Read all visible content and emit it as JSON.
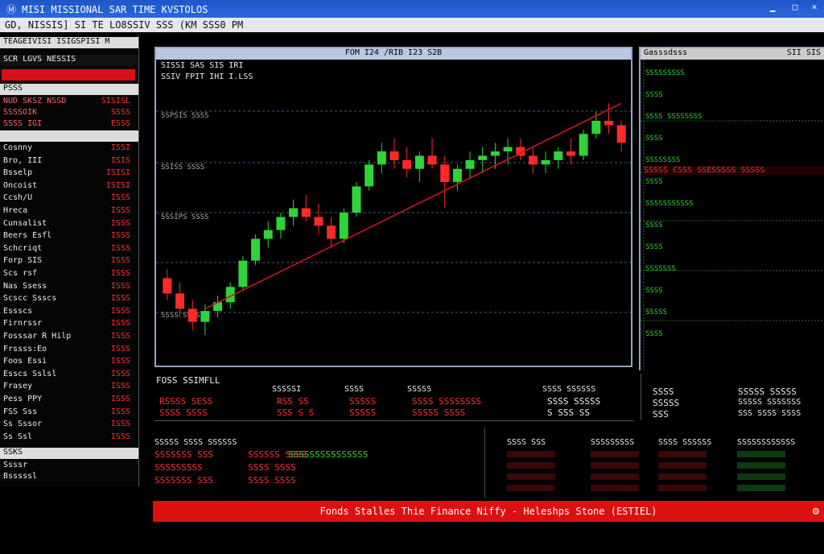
{
  "window": {
    "title": "Ⓜ MISI MISSIONAL SAR TIME KVSTOLOS"
  },
  "menubar": {
    "text": "GD, NISSIS] SI TE LO8SSIV SSS (KM SSS0 PM"
  },
  "left_panel": {
    "title": "TEAGEIVISI ISIGSPISI M",
    "header": "SCR LGVS NESSIS",
    "quotes_header": "PSSS",
    "summary": [
      {
        "name": "NUD SKSZ NSSD",
        "value": "SISISL"
      },
      {
        "name": "SSSSOIK",
        "value": "SSSS"
      },
      {
        "name": "SSSS IGI",
        "value": "ESSS"
      }
    ],
    "rows": [
      {
        "name": "Cosnny",
        "value": "ISSI"
      },
      {
        "name": "Bro, III",
        "value": "ISIS"
      },
      {
        "name": "Bsselp",
        "value": "ISISI"
      },
      {
        "name": "Oncoist",
        "value": "ISISI"
      },
      {
        "name": "Ccsh/U",
        "value": "ISSS"
      },
      {
        "name": "Hreca",
        "value": "ISSS"
      },
      {
        "name": "Cunsalist",
        "value": "ISSS"
      },
      {
        "name": "Beers Esfl",
        "value": "ISSS"
      },
      {
        "name": "Schcriqt",
        "value": "ISSS"
      },
      {
        "name": "Forp SIS",
        "value": "ISSS"
      },
      {
        "name": "Scs rsf",
        "value": "ISSS"
      },
      {
        "name": "Nas Ssess",
        "value": "ISSS"
      },
      {
        "name": "Scscc Ssscs",
        "value": "ISSS"
      },
      {
        "name": "Essscs",
        "value": "ISSS"
      },
      {
        "name": "Firnrssr",
        "value": "ISSS"
      },
      {
        "name": "Fosssar R Hilp",
        "value": "ISSS"
      },
      {
        "name": "Frssss:Eo",
        "value": "ISSS"
      },
      {
        "name": "Foos Essi",
        "value": "ISSS"
      },
      {
        "name": "Esscs Sslsl",
        "value": "ISSS"
      },
      {
        "name": "Frasey",
        "value": "ISSS"
      },
      {
        "name": "Pess PPY",
        "value": "ISSS"
      },
      {
        "name": "FSS Sss",
        "value": "ISSS"
      },
      {
        "name": "Ss Sssor",
        "value": "ISSS"
      },
      {
        "name": "Ss Ssl",
        "value": "ISSS"
      }
    ],
    "footer_header": "SSKS",
    "footer_rows": [
      "Ssssr",
      "Bsssssl"
    ]
  },
  "chart_window": {
    "caption": "FOM I24 /RIB I23 S2B",
    "info_line1": "SISSI SAS SIS IRI",
    "info_line2": "SSIV FPIT IHI I.LSS",
    "grid_labels": [
      "SSPSIS SSSS",
      "SSISS SSSS",
      "SSSIPS SSSS",
      "SSSS SSSS"
    ]
  },
  "chart_data": {
    "type": "candlestick",
    "title": "FOM I24 /RIB I23 S2B",
    "candles": [
      {
        "o": 60,
        "h": 64,
        "l": 50,
        "c": 53,
        "up": false
      },
      {
        "o": 53,
        "h": 58,
        "l": 42,
        "c": 46,
        "up": false
      },
      {
        "o": 46,
        "h": 50,
        "l": 36,
        "c": 40,
        "up": false
      },
      {
        "o": 40,
        "h": 48,
        "l": 34,
        "c": 45,
        "up": true
      },
      {
        "o": 45,
        "h": 52,
        "l": 42,
        "c": 49,
        "up": true
      },
      {
        "o": 49,
        "h": 58,
        "l": 46,
        "c": 56,
        "up": true
      },
      {
        "o": 56,
        "h": 70,
        "l": 54,
        "c": 68,
        "up": true
      },
      {
        "o": 68,
        "h": 80,
        "l": 66,
        "c": 78,
        "up": true
      },
      {
        "o": 78,
        "h": 86,
        "l": 74,
        "c": 82,
        "up": true
      },
      {
        "o": 82,
        "h": 90,
        "l": 78,
        "c": 88,
        "up": true
      },
      {
        "o": 88,
        "h": 96,
        "l": 84,
        "c": 92,
        "up": true
      },
      {
        "o": 92,
        "h": 98,
        "l": 86,
        "c": 88,
        "up": false
      },
      {
        "o": 88,
        "h": 94,
        "l": 80,
        "c": 84,
        "up": false
      },
      {
        "o": 84,
        "h": 88,
        "l": 74,
        "c": 78,
        "up": false
      },
      {
        "o": 78,
        "h": 92,
        "l": 76,
        "c": 90,
        "up": true
      },
      {
        "o": 90,
        "h": 104,
        "l": 88,
        "c": 102,
        "up": true
      },
      {
        "o": 102,
        "h": 114,
        "l": 100,
        "c": 112,
        "up": true
      },
      {
        "o": 112,
        "h": 122,
        "l": 108,
        "c": 118,
        "up": true
      },
      {
        "o": 118,
        "h": 124,
        "l": 110,
        "c": 114,
        "up": false
      },
      {
        "o": 114,
        "h": 120,
        "l": 106,
        "c": 110,
        "up": false
      },
      {
        "o": 110,
        "h": 118,
        "l": 104,
        "c": 116,
        "up": true
      },
      {
        "o": 116,
        "h": 124,
        "l": 110,
        "c": 112,
        "up": false
      },
      {
        "o": 112,
        "h": 116,
        "l": 92,
        "c": 104,
        "up": false
      },
      {
        "o": 104,
        "h": 112,
        "l": 100,
        "c": 110,
        "up": true
      },
      {
        "o": 110,
        "h": 118,
        "l": 106,
        "c": 114,
        "up": true
      },
      {
        "o": 114,
        "h": 120,
        "l": 108,
        "c": 116,
        "up": true
      },
      {
        "o": 116,
        "h": 122,
        "l": 110,
        "c": 118,
        "up": true
      },
      {
        "o": 118,
        "h": 124,
        "l": 112,
        "c": 120,
        "up": true
      },
      {
        "o": 120,
        "h": 124,
        "l": 114,
        "c": 116,
        "up": false
      },
      {
        "o": 116,
        "h": 120,
        "l": 108,
        "c": 112,
        "up": false
      },
      {
        "o": 112,
        "h": 118,
        "l": 108,
        "c": 114,
        "up": true
      },
      {
        "o": 114,
        "h": 120,
        "l": 110,
        "c": 118,
        "up": true
      },
      {
        "o": 118,
        "h": 124,
        "l": 112,
        "c": 116,
        "up": false
      },
      {
        "o": 116,
        "h": 128,
        "l": 114,
        "c": 126,
        "up": true
      },
      {
        "o": 126,
        "h": 136,
        "l": 124,
        "c": 132,
        "up": true
      },
      {
        "o": 132,
        "h": 140,
        "l": 126,
        "c": 130,
        "up": false
      },
      {
        "o": 130,
        "h": 132,
        "l": 118,
        "c": 122,
        "up": false
      }
    ],
    "trendline": [
      {
        "i": 3,
        "v": 46
      },
      {
        "i": 36,
        "v": 140
      }
    ],
    "ylim": [
      20,
      160
    ],
    "colors": {
      "up": "#2fd43a",
      "down": "#ff2a2a",
      "trend": "#c81818"
    }
  },
  "right_panel": {
    "caption": "Gasssdsss",
    "caption_right": "SII SIS",
    "rows": [
      "SSSSSSSSS",
      "SSSS",
      "SSSS SSSSSSSS",
      "SSSS",
      "SSSSSSSS",
      "SSSS",
      "SSSSSSSSSSS",
      "SSSS",
      "SSSS",
      "SSSSSSS",
      "SSSS",
      "SSSSS",
      "SSSS"
    ],
    "red_row": "SSSSS CSSS SSESSSSS SSSSS"
  },
  "mid_info": {
    "label": "FOSS SSIMFLL",
    "cols": [
      {
        "head": "",
        "l1": "RSSSS SESS",
        "l2": "SSSS SSSS"
      },
      {
        "head": "SSSSSI",
        "l1": "RSS SS",
        "l2": "SSS S S"
      },
      {
        "head": "SSSS",
        "l1": "SSSSS",
        "l2": "SSSSS"
      },
      {
        "head": "SSSSS",
        "l1": "SSSS SSSSSSSS",
        "l2": "SSSSS SSSS"
      },
      {
        "head": "SSSS SSSSSS",
        "l1": "SSSS SSSSS",
        "l2": "S SSS SS"
      }
    ]
  },
  "right_info": {
    "c1": {
      "head": "SSSS",
      "l1": "SSSSS",
      "l2": "SSS"
    },
    "c2": {
      "head": "SSSSS SSSSS",
      "l1": "SSSSS SSSSSSS",
      "l2": "SSS SSSS SSSS"
    }
  },
  "bottom": {
    "label": "SSSSS SSSS SSSSSS",
    "cols": [
      {
        "lines": [
          "SSSSSSS SSS",
          "SSSSSSSSS",
          "SSSSSSS SSS"
        ]
      },
      {
        "lines": [
          "SSSSSS SSSS",
          "SSSS SSSS",
          "SSSS SSSS"
        ]
      },
      {
        "lines": [
          "SSSSSSSSSSSSSSS"
        ]
      }
    ],
    "right_heads": [
      "SSSS SSS",
      "SSSSSSSSS",
      "SSSS SSSSSS",
      "SSSSSSSSSSSS"
    ]
  },
  "status": {
    "text": "Fonds Stalles Thie Finance Niffy - Heleshps Stone  (ESTIEL)"
  }
}
